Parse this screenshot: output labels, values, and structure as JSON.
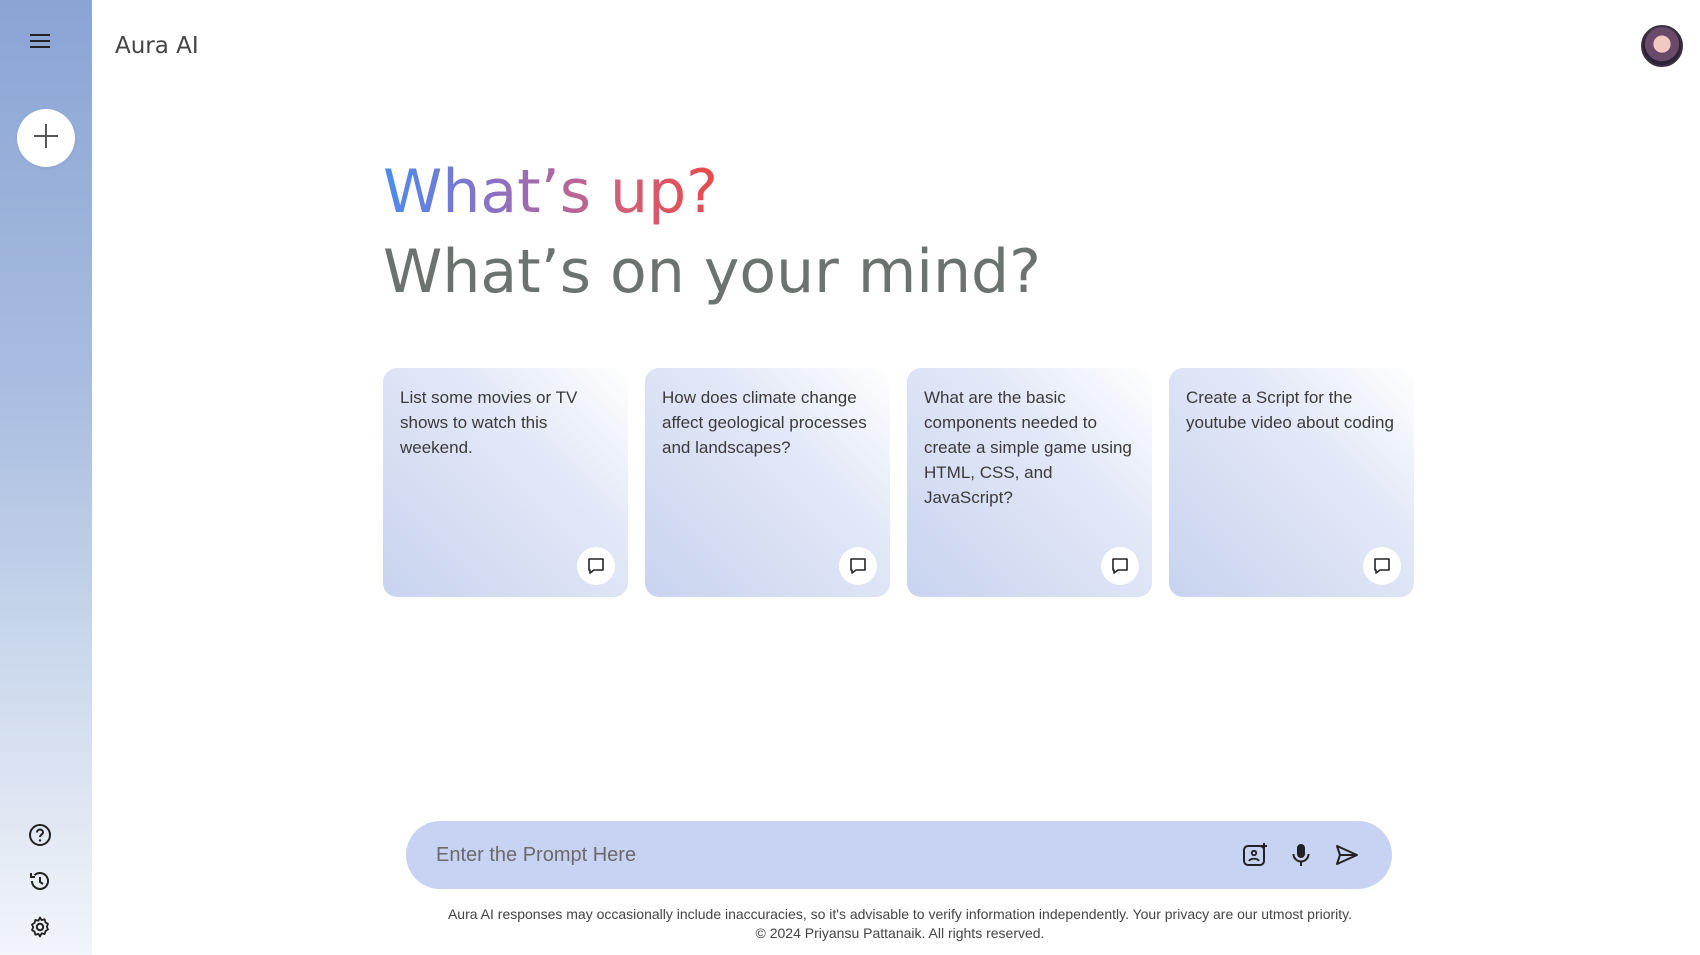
{
  "app": {
    "title": "Aura AI"
  },
  "greeting": {
    "line1": "What’s up?",
    "line2": "What’s on your mind?"
  },
  "cards": [
    {
      "text": "List some movies or TV shows to watch this weekend.",
      "icon": "message-icon"
    },
    {
      "text": "How does climate change affect geological processes and landscapes?",
      "icon": "message-icon"
    },
    {
      "text": "What are the basic components needed to create a simple game using HTML, CSS, and JavaScript?",
      "icon": "message-icon"
    },
    {
      "text": "Create a Script for the youtube video about coding",
      "icon": "message-icon"
    }
  ],
  "prompt": {
    "placeholder": "Enter the Prompt Here",
    "value": ""
  },
  "footer": {
    "disclaimer": "Aura AI responses may occasionally include inaccuracies, so it's advisable to verify information independently. Your privacy are our utmost priority.",
    "copyright": "© 2024 Priyansu Pattanaik. All rights reserved."
  },
  "colors": {
    "prompt_bg": "#c8d3f3",
    "sidebar_top": "#8aa4d4",
    "greeting_gray": "#6c736e"
  },
  "icons": [
    "menu-icon",
    "plus-icon",
    "help-icon",
    "history-icon",
    "settings-icon",
    "image-icon",
    "mic-icon",
    "send-icon",
    "message-icon"
  ]
}
